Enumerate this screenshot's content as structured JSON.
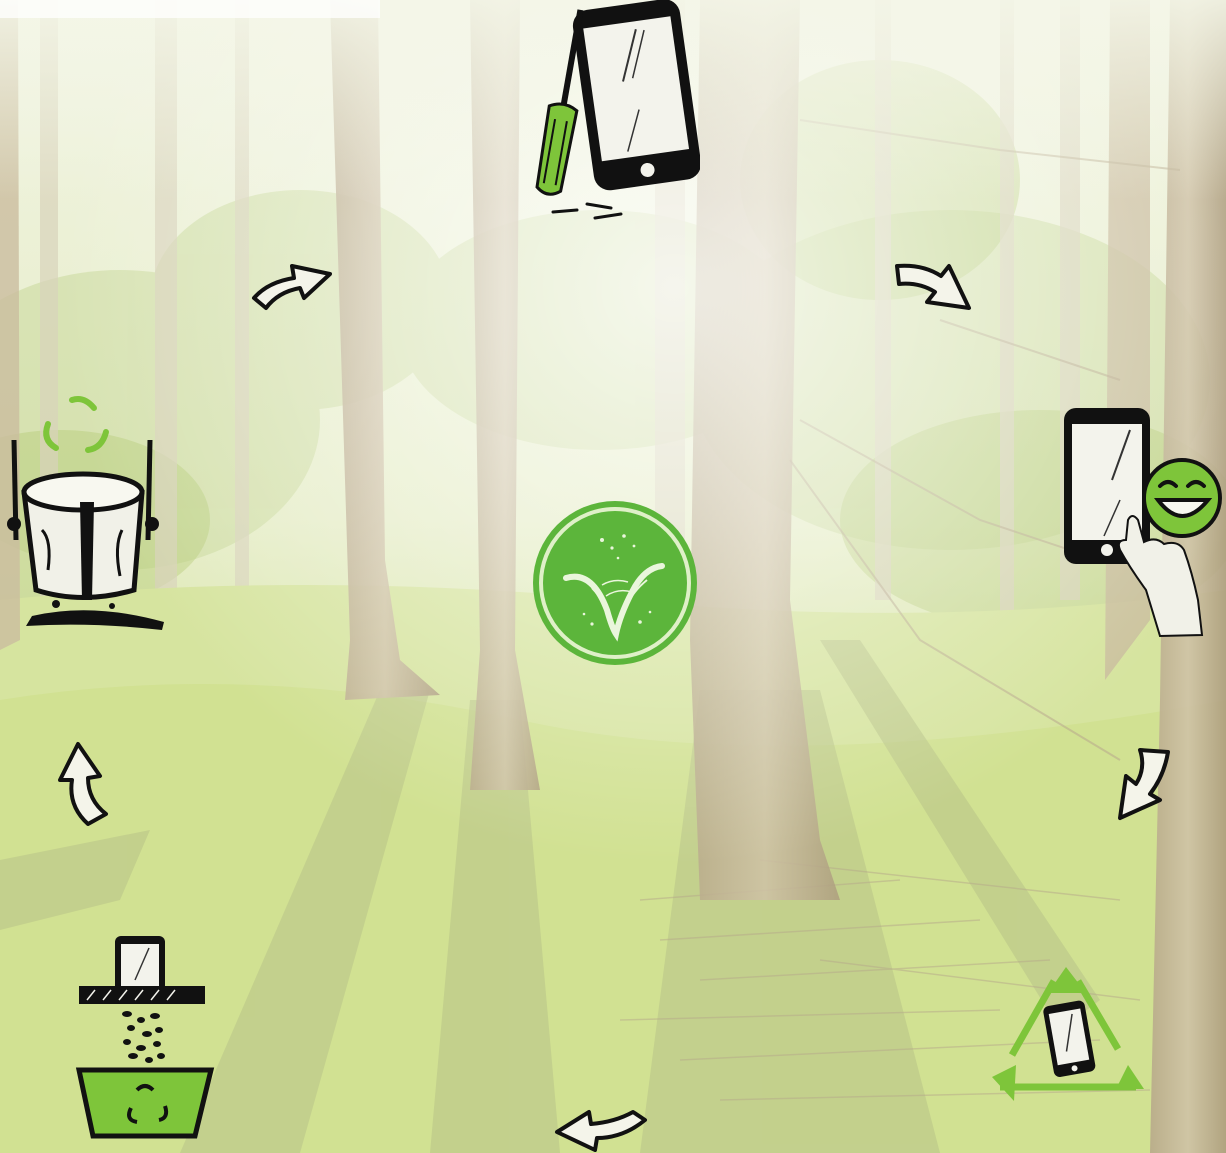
{
  "colors": {
    "sky": "#eef2dc",
    "fog": "#f3f5e6",
    "trunk": "#c7b89b",
    "trunk_dark": "#a89878",
    "moss": "#c9dc88",
    "moss_light": "#dbe8a8",
    "shadow": "#b9c48c",
    "accent_green": "#7ec53a",
    "logo_green": "#5cb53b",
    "ink": "#111111"
  },
  "cycle": {
    "center_logo": "brand-leaf-logo",
    "steps": [
      {
        "name": "repair-phone",
        "icon": "screwdriver-phone-icon"
      },
      {
        "name": "happy-user",
        "icon": "phone-touch-smiley-icon"
      },
      {
        "name": "recycle-device",
        "icon": "recycle-triangle-phone-icon"
      },
      {
        "name": "shred-phone",
        "icon": "shredder-bin-icon"
      },
      {
        "name": "melt-material",
        "icon": "crucible-pour-icon"
      }
    ],
    "arrows": [
      "arrow-icon",
      "arrow-icon",
      "arrow-icon",
      "arrow-icon",
      "arrow-icon",
      "arrow-icon"
    ]
  }
}
